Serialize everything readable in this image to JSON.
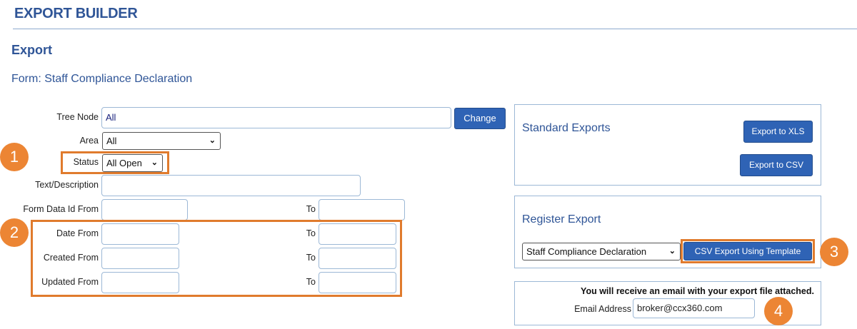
{
  "header": {
    "title": "EXPORT BUILDER"
  },
  "section": {
    "title": "Export"
  },
  "form": {
    "title": "Form: Staff Compliance Declaration"
  },
  "fields": {
    "tree_node": {
      "label": "Tree Node",
      "value": "All",
      "button": "Change"
    },
    "area": {
      "label": "Area",
      "value": "All"
    },
    "status": {
      "label": "Status",
      "value": "All Open"
    },
    "text_description": {
      "label": "Text/Description",
      "value": ""
    },
    "form_data_id": {
      "label": "Form Data Id From",
      "to_label": "To"
    },
    "date": {
      "label": "Date From",
      "to_label": "To"
    },
    "created": {
      "label": "Created From",
      "to_label": "To"
    },
    "updated": {
      "label": "Updated From",
      "to_label": "To"
    }
  },
  "standard_exports": {
    "title": "Standard Exports",
    "xls_button": "Export to XLS",
    "csv_button": "Export to CSV"
  },
  "register_export": {
    "title": "Register Export",
    "template_value": "Staff Compliance Declaration",
    "template_button": "CSV Export Using Template"
  },
  "email": {
    "notice": "You will receive an email with your export file attached.",
    "label": "Email Address",
    "value": "broker@ccx360.com"
  },
  "badges": [
    "1",
    "2",
    "3",
    "4"
  ],
  "colors": {
    "accent": "#2f5597",
    "button": "#2f63b5",
    "highlight": "#e07b2d"
  }
}
